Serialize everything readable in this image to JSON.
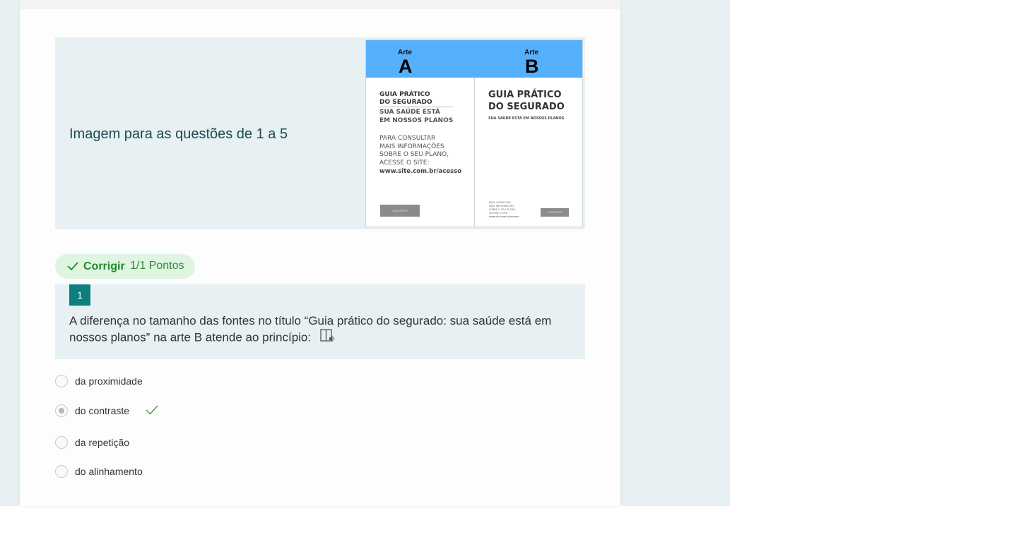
{
  "image_section": {
    "title": "Imagem para as questões de 1 a 5",
    "art_a": {
      "label": "Arte",
      "letter": "A",
      "title_line1": "GUIA PRÁTICO",
      "title_line2": "DO SEGURADO",
      "subtitle_line1": "SUA SAÚDE ESTÁ",
      "subtitle_line2": "EM NOSSOS PLANOS",
      "body_line1": "PARA CONSULTAR",
      "body_line2": "MAIS INFORMAÇÕES",
      "body_line3": "SOBRE O SEU PLANO,",
      "body_line4": "ACESSE O SITE:",
      "url": "www.site.com.br/acesso",
      "button": "LOGOTIPO"
    },
    "art_b": {
      "label": "Arte",
      "letter": "B",
      "title_line1": "GUIA PRÁTICO",
      "title_line2": "DO SEGURADO",
      "subtitle": "SUA SAÚDE ESTÁ EM NOSSOS PLANOS",
      "body_line1": "PARA CONSULTAR",
      "body_line2": "MAIS INFORMAÇÕES",
      "body_line3": "SOBRE O SEU PLANO,",
      "body_line4": "ACESSE O SITE:",
      "url": "www.site.com.br/acesso",
      "button": "LOGOTIPO"
    }
  },
  "result": {
    "status": "Corrigir",
    "points": "1/1 Pontos",
    "color": "#1f8a2a"
  },
  "question": {
    "number": "1",
    "text_line1": "A diferença no tamanho das fontes no título “Guia prático do segurado: sua saúde está em",
    "text_line2": "nossos planos” na arte B atende ao princípio:",
    "reader_icon": "immersive-reader-icon"
  },
  "options": [
    {
      "label": "da proximidade",
      "selected": false
    },
    {
      "label": "do contraste",
      "selected": true,
      "correct": true
    },
    {
      "label": "da repetição",
      "selected": false
    },
    {
      "label": "do alinhamento",
      "selected": false
    }
  ],
  "colors": {
    "accent": "#0b7f7f",
    "page_background": "#e7f0f2",
    "art_header": "#55b0fc",
    "success": "#1f8a2a"
  }
}
